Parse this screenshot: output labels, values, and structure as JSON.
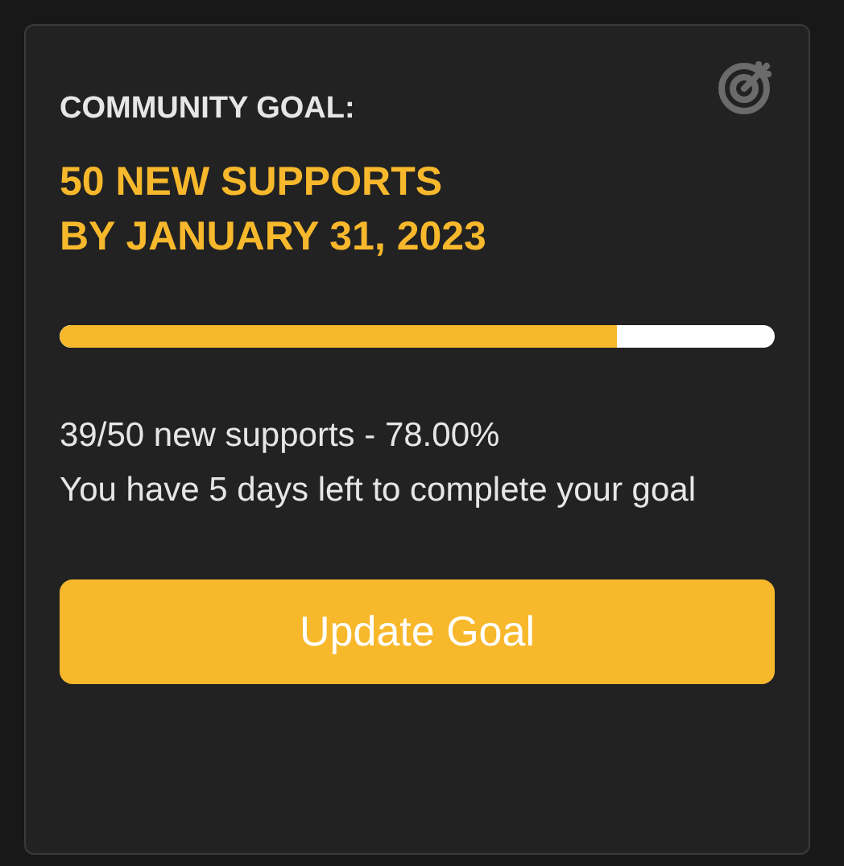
{
  "card": {
    "title": "COMMUNITY GOAL:",
    "goal_lines": [
      "50 NEW SUPPORTS",
      "BY JANUARY 31, 2023"
    ],
    "progress": {
      "level": 0.78
    },
    "summary": "39/50 new supports - 78.00%",
    "message": "You have 5 days left to complete your goal",
    "button": "Update Goal"
  }
}
